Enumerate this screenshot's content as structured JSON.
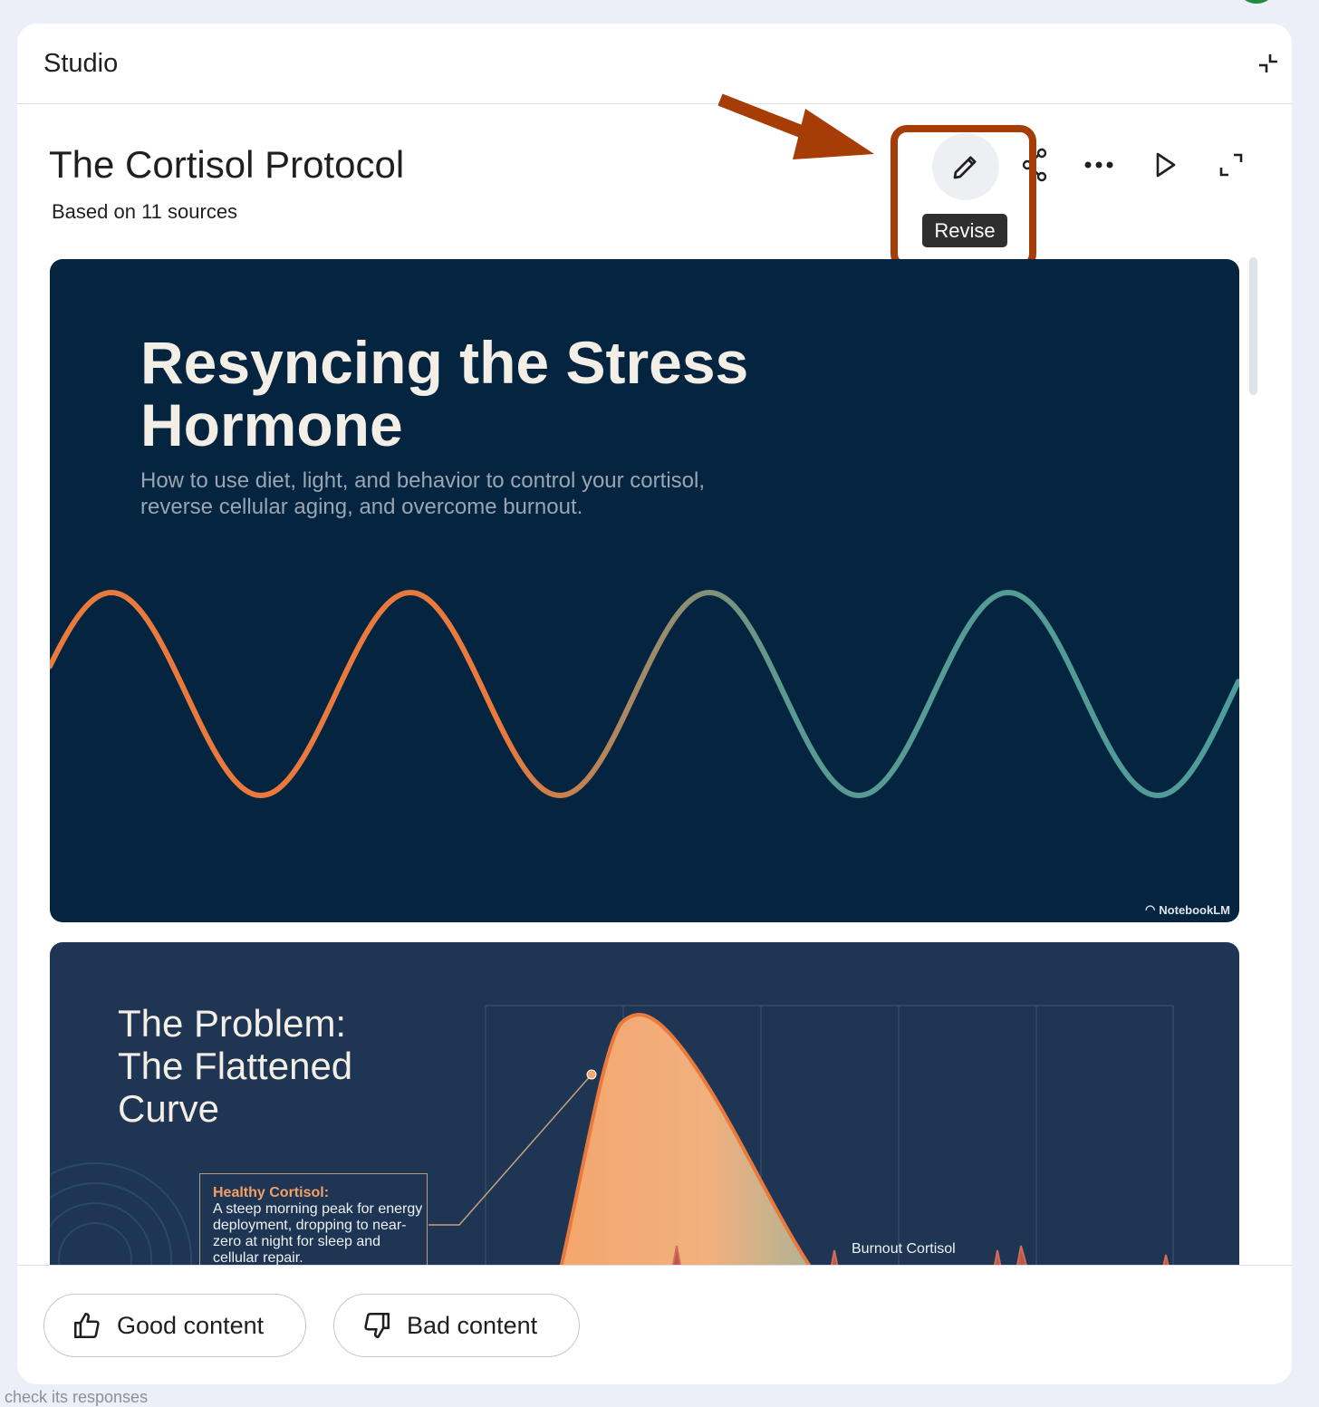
{
  "panel": {
    "title": "Studio",
    "collapse_icon": "collapse-icon"
  },
  "artifact": {
    "title": "The Cortisol Protocol",
    "subtitle": "Based on 11 sources",
    "actions": {
      "revise_icon": "pencil-icon",
      "tooltip": "Revise",
      "share_icon": "share-icon",
      "more_icon": "more-horiz-icon",
      "play_icon": "play-icon",
      "fullscreen_icon": "fullscreen-icon"
    }
  },
  "annotation": {
    "arrow_color": "#a63c06",
    "box_color": "#a63c06"
  },
  "slides": [
    {
      "title": "Resyncing the Stress Hormone",
      "subtitle": "How to use diet, light, and behavior to control your cortisol, reverse cellular aging, and overcome burnout.",
      "brand": "NotebookLM",
      "wave_colors": [
        "#e9793c",
        "#4e9d9a"
      ],
      "background": "#05243f"
    },
    {
      "title": "The Problem: The Flattened Curve",
      "callout_title": "Healthy Cortisol:",
      "callout_body": "A steep morning peak for energy deployment, dropping to near-zero at night for sleep and cellular repair.",
      "series_label": "Burnout Cortisol",
      "background": "#1e3553"
    }
  ],
  "feedback": {
    "good_label": "Good content",
    "bad_label": "Bad content",
    "good_icon": "thumbs-up-icon",
    "bad_icon": "thumbs-down-icon"
  },
  "footer_text": "check its responses"
}
